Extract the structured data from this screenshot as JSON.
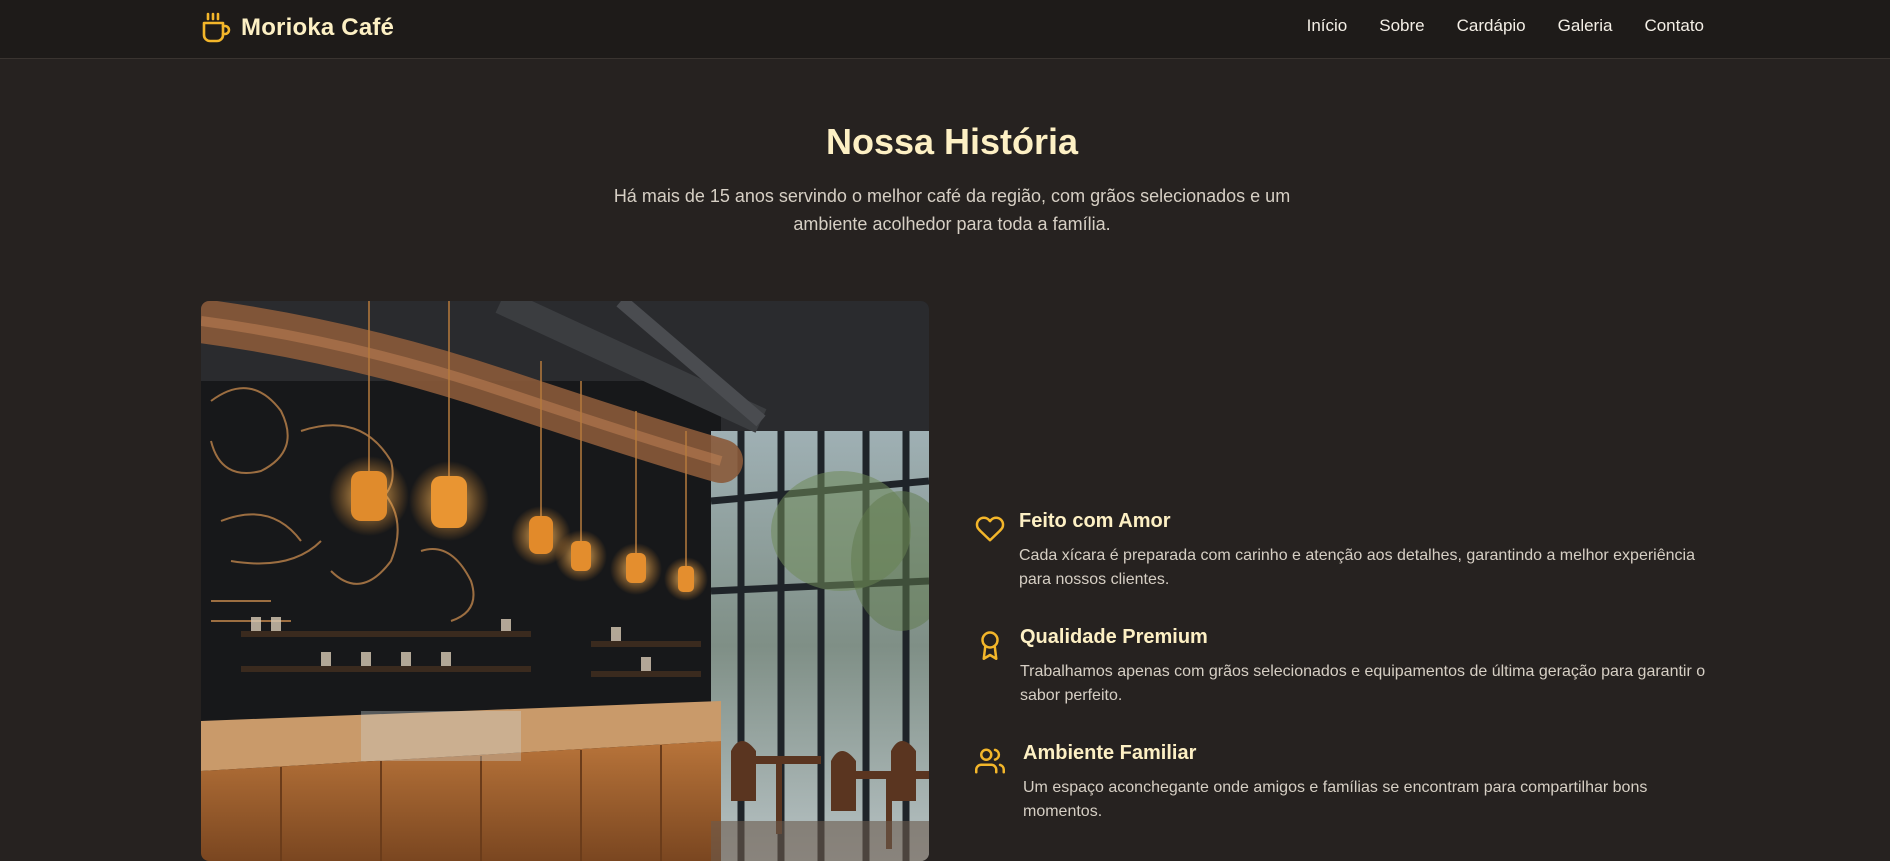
{
  "brand": {
    "name": "Morioka Café",
    "icon": "coffee-cup-icon",
    "accent": "#f3b62a"
  },
  "nav": {
    "links": [
      "Início",
      "Sobre",
      "Cardápio",
      "Galeria",
      "Contato"
    ]
  },
  "history": {
    "title": "Nossa História",
    "subtitle": "Há mais de 15 anos servindo o melhor café da região, com grãos selecionados e um ambiente acolhedor para toda a família."
  },
  "features": [
    {
      "icon": "heart-icon",
      "title": "Feito com Amor",
      "description": "Cada xícara é preparada com carinho e atenção aos detalhes, garantindo a melhor experiência para nossos clientes."
    },
    {
      "icon": "award-icon",
      "title": "Qualidade Premium",
      "description": "Trabalhamos apenas com grãos selecionados e equipamentos de última geração para garantir o sabor perfeito."
    },
    {
      "icon": "users-icon",
      "title": "Ambiente Familiar",
      "description": "Um espaço aconchegante onde amigos e famílias se encontram para compartilhar bons momentos."
    }
  ],
  "colors": {
    "background": "#262220",
    "navbar": "#1e1b19",
    "heading": "#fdf0c4",
    "accent": "#f3b62a"
  }
}
